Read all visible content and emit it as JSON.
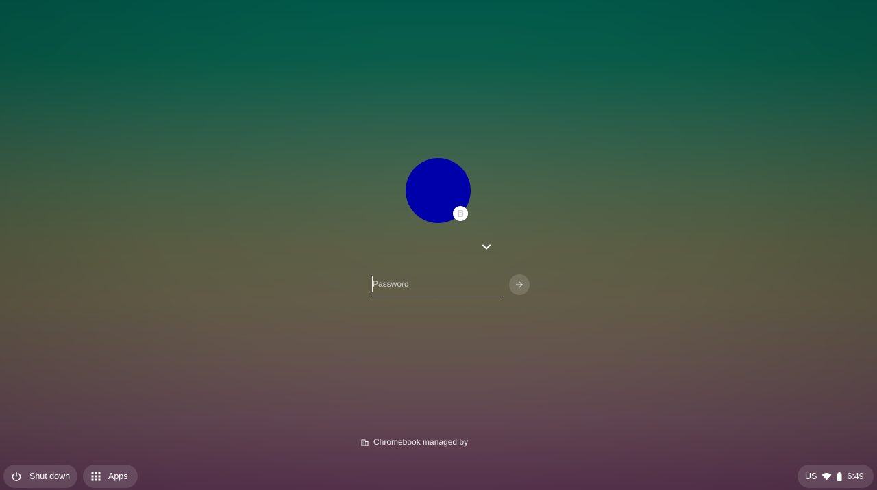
{
  "login": {
    "password_placeholder": "Password",
    "password_value": "",
    "avatar_color": "#0000aa"
  },
  "footer": {
    "managed_text": "Chromebook managed by"
  },
  "shelf": {
    "shutdown_label": "Shut down",
    "apps_label": "Apps"
  },
  "tray": {
    "ime": "US",
    "time": "6:49"
  },
  "icons": {
    "enterprise_badge": "enterprise-icon",
    "dropdown": "chevron-down-icon",
    "submit": "arrow-right-icon",
    "managed": "building-icon",
    "shutdown": "power-icon",
    "apps": "apps-grid-icon",
    "wifi": "wifi-icon",
    "battery": "battery-icon"
  }
}
